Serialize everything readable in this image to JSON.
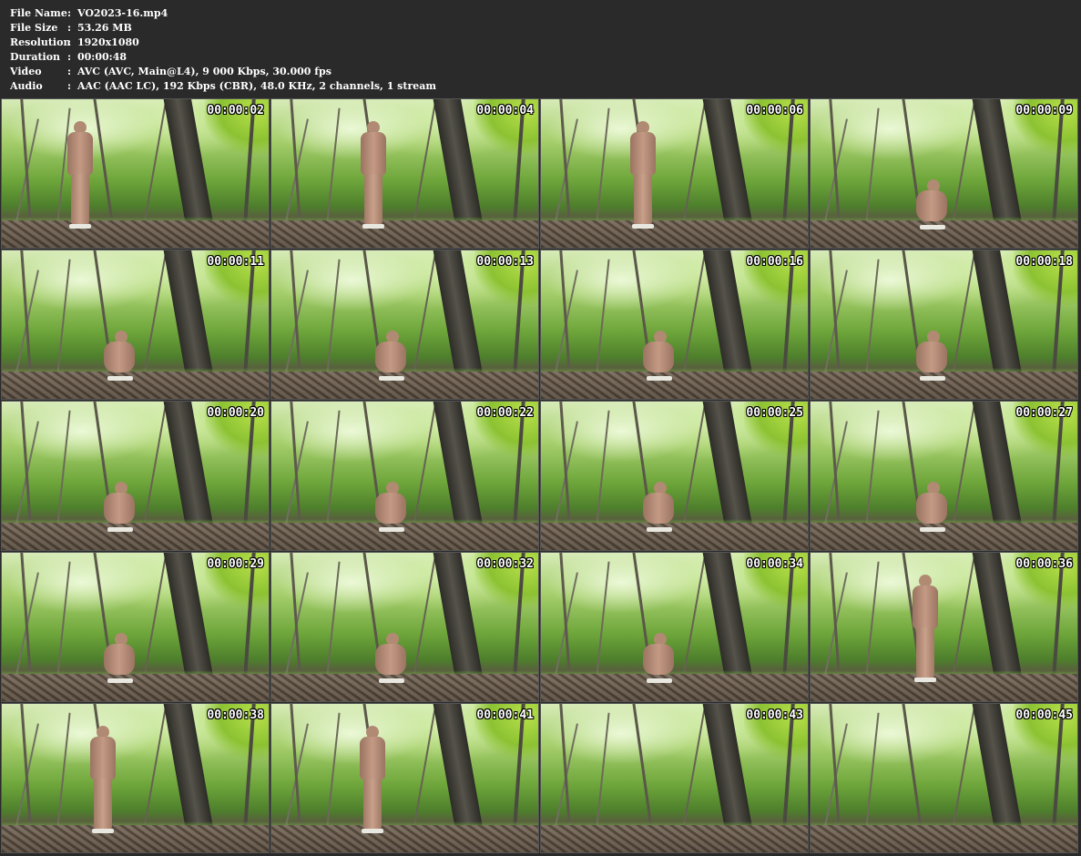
{
  "file_info": [
    {
      "label": "File Name",
      "value": "VO2023-16.mp4"
    },
    {
      "label": "File Size",
      "value": "53.26 MB"
    },
    {
      "label": "Resolution",
      "value": "1920x1080"
    },
    {
      "label": "Duration",
      "value": "00:00:48"
    },
    {
      "label": "Video",
      "value": "AVC (AVC, Main@L4), 9 000 Kbps, 30.000 fps"
    },
    {
      "label": "Audio",
      "value": "AAC (AAC LC), 192 Kbps (CBR), 48.0 KHz, 2 channels, 1 stream"
    }
  ],
  "separator": ":",
  "thumbnails": [
    {
      "timestamp": "00:00:02",
      "figure": "standing"
    },
    {
      "timestamp": "00:00:04",
      "figure": "standing"
    },
    {
      "timestamp": "00:00:06",
      "figure": "standing"
    },
    {
      "timestamp": "00:00:09",
      "figure": "squatting"
    },
    {
      "timestamp": "00:00:11",
      "figure": "squatting"
    },
    {
      "timestamp": "00:00:13",
      "figure": "squatting"
    },
    {
      "timestamp": "00:00:16",
      "figure": "squatting"
    },
    {
      "timestamp": "00:00:18",
      "figure": "squatting"
    },
    {
      "timestamp": "00:00:20",
      "figure": "squatting"
    },
    {
      "timestamp": "00:00:22",
      "figure": "squatting"
    },
    {
      "timestamp": "00:00:25",
      "figure": "squatting"
    },
    {
      "timestamp": "00:00:27",
      "figure": "squatting"
    },
    {
      "timestamp": "00:00:29",
      "figure": "squatting"
    },
    {
      "timestamp": "00:00:32",
      "figure": "squatting"
    },
    {
      "timestamp": "00:00:34",
      "figure": "squatting"
    },
    {
      "timestamp": "00:00:36",
      "figure": "standing"
    },
    {
      "timestamp": "00:00:38",
      "figure": "standing"
    },
    {
      "timestamp": "00:00:41",
      "figure": "standing"
    },
    {
      "timestamp": "00:00:43",
      "figure": "none"
    },
    {
      "timestamp": "00:00:45",
      "figure": "none"
    }
  ],
  "colors": {
    "background": "#2a2a2a",
    "text": "#ffffff",
    "foliage": "#8cc232"
  }
}
